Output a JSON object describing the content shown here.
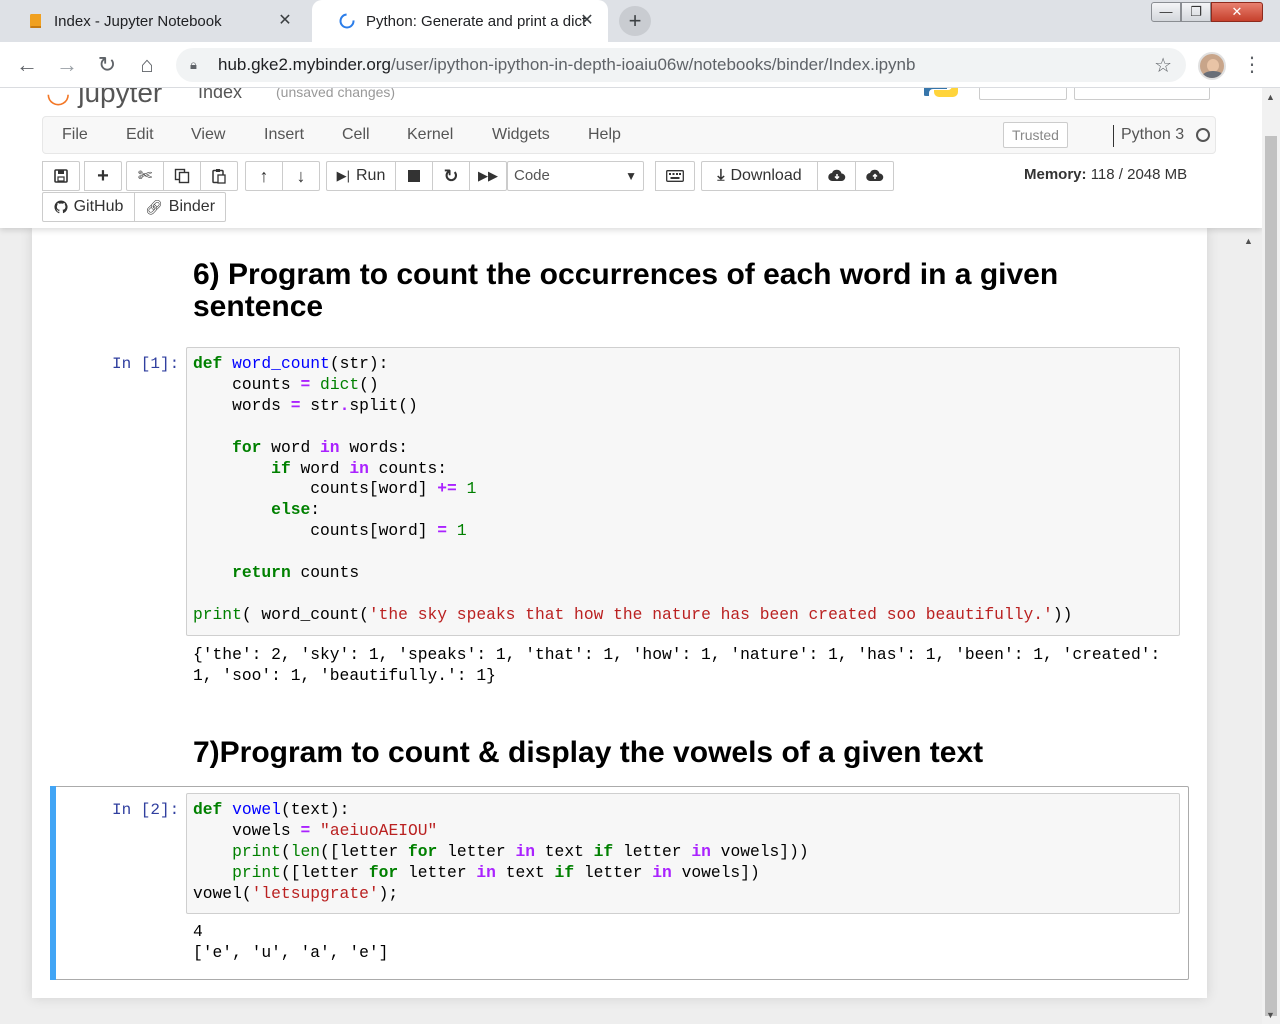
{
  "browser": {
    "tabs": [
      {
        "title": "Index - Jupyter Notebook",
        "favicon": "book-icon"
      },
      {
        "title": "Python: Generate and print a dict",
        "favicon": "w3resource-icon"
      }
    ],
    "url_host": "hub.gke2.mybinder.org",
    "url_path": "/user/ipython-ipython-in-depth-ioaiu06w/notebooks/binder/Index.ipynb"
  },
  "jupyter": {
    "logo_text": "jupyter",
    "notebook_name": "Index",
    "save_status": "(unsaved changes)",
    "menu": [
      "File",
      "Edit",
      "View",
      "Insert",
      "Cell",
      "Kernel",
      "Widgets",
      "Help"
    ],
    "trusted_label": "Trusted",
    "kernel_name": "Python 3",
    "toolbar": {
      "run_label": "Run",
      "cell_type": "Code",
      "download_label": "Download",
      "github_label": "GitHub",
      "binder_label": "Binder"
    },
    "memory_label": "Memory:",
    "memory_value": "118 / 2048 MB"
  },
  "notebook": {
    "heading6": "6) Program to count the occurrences of each word in a given sentence",
    "cell1_prompt": "In [1]:",
    "cell1_output": "{'the': 2, 'sky': 1, 'speaks': 1, 'that': 1, 'how': 1, 'nature': 1, 'has': 1, 'been': 1, 'created':\n1, 'soo': 1, 'beautifully.': 1}",
    "heading7": "7)Program to count & display the vowels of a given text",
    "cell2_prompt": "In [2]:",
    "cell2_output": "4\n['e', 'u', 'a', 'e']"
  }
}
